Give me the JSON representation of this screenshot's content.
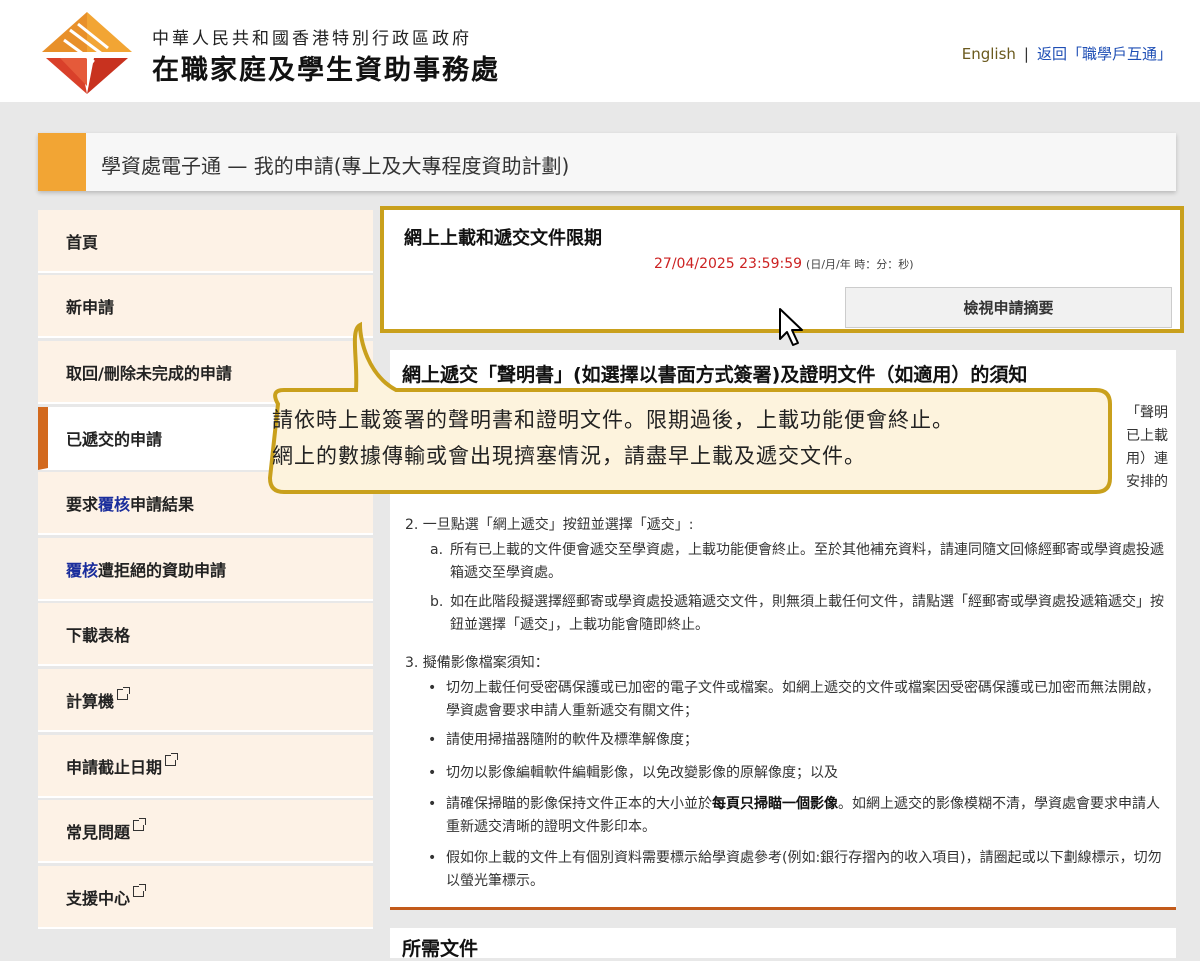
{
  "header": {
    "org_chinese": "中華人民共和國香港特別行政區政府",
    "org_name": "在職家庭及學生資助事務處",
    "lang_link": "English",
    "separator": "|",
    "back_link": "返回「職學戶互通」"
  },
  "page_title": "學資處電子通 — 我的申請(專上及大專程度資助計劃)",
  "sidebar": {
    "items": [
      {
        "label": "首頁"
      },
      {
        "label": "新申請"
      },
      {
        "label": "取回/刪除未完成的申請"
      },
      {
        "label": "已遞交的申請",
        "active": true
      },
      {
        "label_pre": "要求",
        "label_hl": "覆核",
        "label_post": "申請結果"
      },
      {
        "label_hl": "覆核",
        "label_post": "遭拒絕的資助申請"
      },
      {
        "label": "下載表格"
      },
      {
        "label": "計算機",
        "external": true
      },
      {
        "label": "申請截止日期",
        "external": true
      },
      {
        "label": "常見問題",
        "external": true
      },
      {
        "label": "支援中心",
        "external": true
      }
    ]
  },
  "deadline": {
    "title": "網上上載和遞交文件限期",
    "date": "27/04/2025 23:59:59",
    "format": "(日/月/年 時：分：秒)",
    "view_button": "檢視申請摘要"
  },
  "notice": {
    "heading": "網上遞交「聲明書」(如選擇以書面方式簽署)及證明文件（如適用）的須知",
    "partial_right": [
      "「聲明",
      "已上載",
      "用）連",
      "安排的"
    ],
    "point2": "2. 一旦點選「網上遞交」按鈕並選擇「遞交」:",
    "point2a_label": "a.",
    "point2a": "所有已上載的文件便會遞交至學資處，上載功能便會終止。至於其他補充資料，請連同隨文回條經郵寄或學資處投遞箱遞交至學資處。",
    "point2b_label": "b.",
    "point2b": "如在此階段擬選擇經郵寄或學資處投遞箱遞交文件，則無須上載任何文件，請點選「經郵寄或學資處投遞箱遞交」按鈕並選擇「遞交」，上載功能會隨即終止。",
    "point3": "3. 擬備影像檔案須知：",
    "bullet1": "切勿上載任何受密碼保護或已加密的電子文件或檔案。如網上遞交的文件或檔案因受密碼保護或已加密而無法開啟，學資處會要求申請人重新遞交有關文件；",
    "bullet2": "請使用掃描器隨附的軟件及標準解像度；",
    "bullet3": "切勿以影像編輯軟件編輯影像，以免改變影像的原解像度；以及",
    "bullet4_pre": "請確保掃瞄的影像保持文件正本的大小並於",
    "bullet4_bold": "每頁只掃瞄一個影像",
    "bullet4_post": "。如網上遞交的影像模糊不清，學資處會要求申請人重新遞交清晰的證明文件影印本。",
    "bullet5": "假如你上載的文件上有個別資料需要標示給學資處參考(例如:銀行存摺內的收入項目)，請圈起或以下劃線標示，切勿以螢光筆標示。"
  },
  "section2_title": "所需文件",
  "callout": {
    "line1": "請依時上載簽署的聲明書和證明文件。限期過後，上載功能便會終止。",
    "line2": "網上的數據傳輸或會出現擠塞情況，請盡早上載及遞交文件。"
  },
  "colors": {
    "accent_orange": "#f2a534",
    "callout_border": "#c9a01c",
    "callout_fill": "#fdf3dd",
    "deadline_red": "#cc2222",
    "active_marker": "#d2691e",
    "link_blue": "#1f4fb5"
  }
}
